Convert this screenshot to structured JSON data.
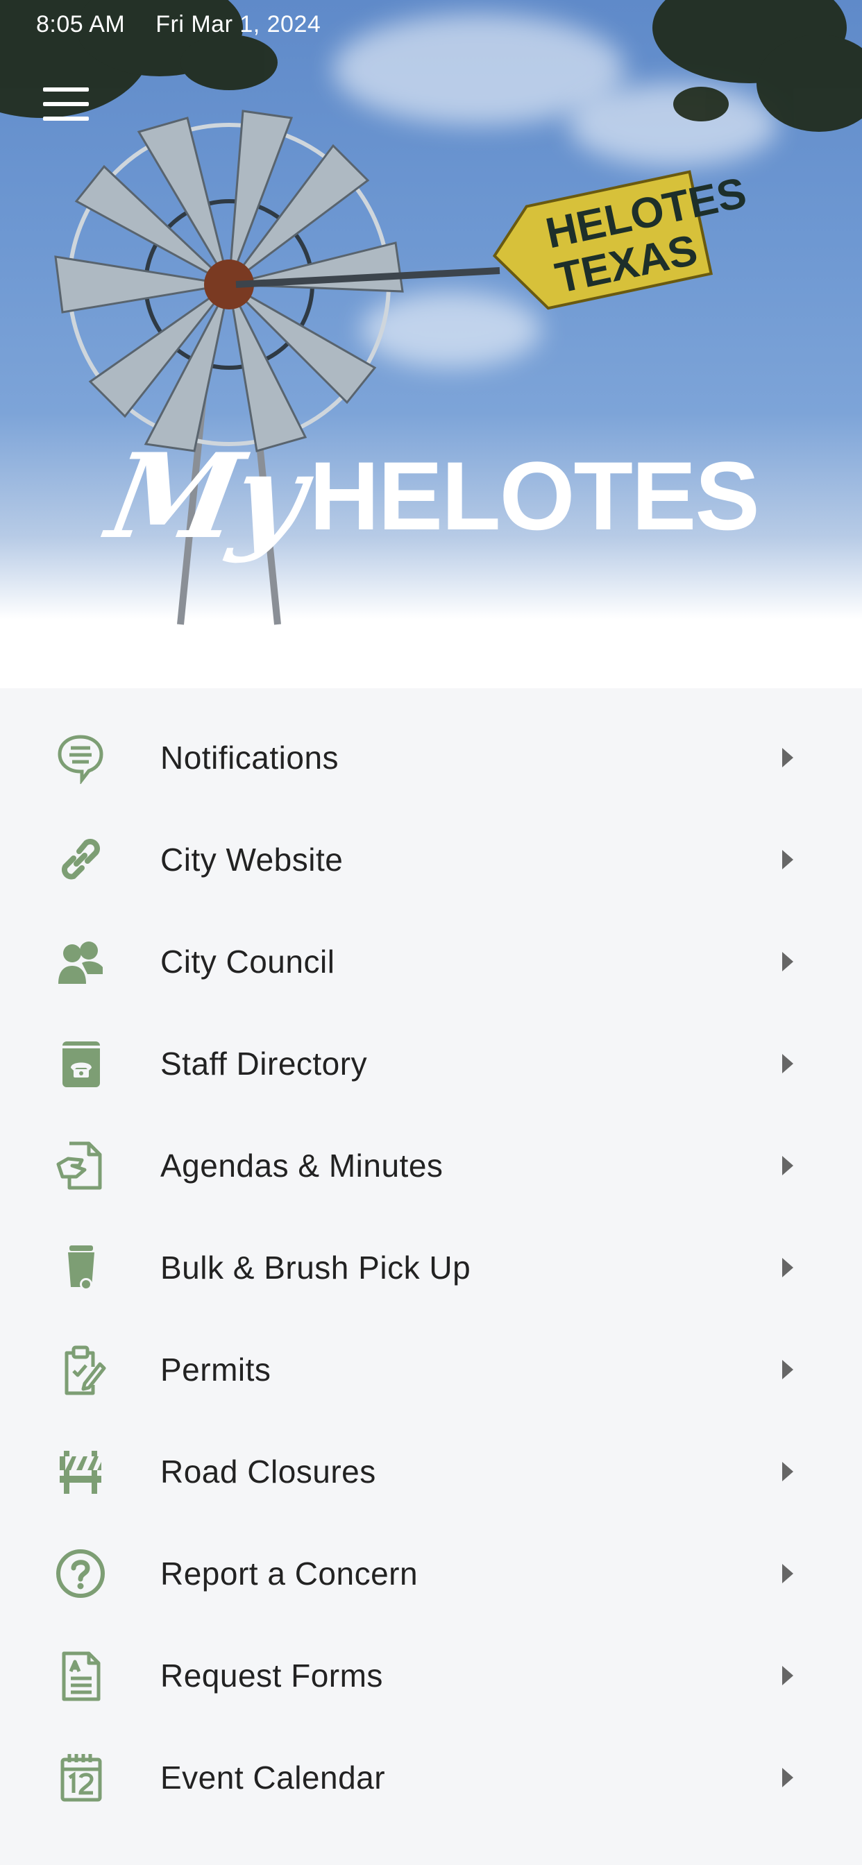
{
  "status_bar": {
    "time": "8:05 AM",
    "date": "Fri Mar 1, 2024"
  },
  "header": {
    "logo_script": "My",
    "logo_text": "HELOTES",
    "sign_line1": "HELOTES",
    "sign_line2": "TEXAS"
  },
  "colors": {
    "icon_green": "#7d9e74",
    "sky": "#6e98d2",
    "list_bg": "#f5f6f8",
    "text": "#222222"
  },
  "menu": [
    {
      "label": "Notifications",
      "icon": "chat-bubble-icon"
    },
    {
      "label": "City Website",
      "icon": "link-icon"
    },
    {
      "label": "City Council",
      "icon": "people-icon"
    },
    {
      "label": "Staff Directory",
      "icon": "phone-book-icon"
    },
    {
      "label": "Agendas & Minutes",
      "icon": "document-hand-icon"
    },
    {
      "label": "Bulk & Brush Pick Up",
      "icon": "trash-bin-icon"
    },
    {
      "label": "Permits",
      "icon": "clipboard-edit-icon"
    },
    {
      "label": "Road Closures",
      "icon": "road-barrier-icon"
    },
    {
      "label": "Report a Concern",
      "icon": "question-circle-icon"
    },
    {
      "label": "Request Forms",
      "icon": "form-document-icon"
    },
    {
      "label": "Event Calendar",
      "icon": "calendar-icon"
    }
  ]
}
